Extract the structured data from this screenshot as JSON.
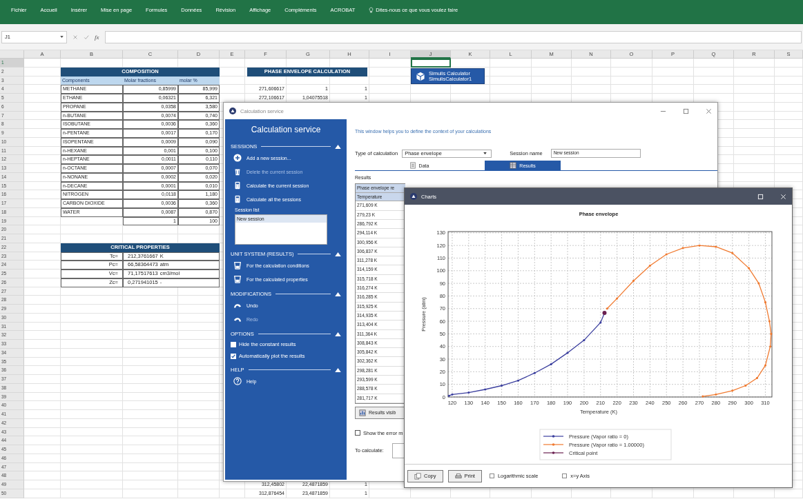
{
  "ribbon": {
    "tabs": [
      {
        "label": "Fichier",
        "selected": false
      },
      {
        "label": "Accueil",
        "selected": false
      },
      {
        "label": "Insérer",
        "selected": false
      },
      {
        "label": "Mise en page",
        "selected": false
      },
      {
        "label": "Formules",
        "selected": false
      },
      {
        "label": "Données",
        "selected": false
      },
      {
        "label": "Révision",
        "selected": false
      },
      {
        "label": "Affichage",
        "selected": false
      },
      {
        "label": "Compléments",
        "selected": false
      },
      {
        "label": "ACROBAT",
        "selected": false
      }
    ],
    "search_hint": "Dites-nous ce que vous voulez faire"
  },
  "formula_bar": {
    "name_box": "J1",
    "function_label": "fx"
  },
  "sheet": {
    "columns": [
      {
        "label": "A",
        "selected": false
      },
      {
        "label": "B",
        "selected": false
      },
      {
        "label": "C",
        "selected": false
      },
      {
        "label": "D",
        "selected": false
      },
      {
        "label": "E",
        "selected": false
      },
      {
        "label": "F",
        "selected": false
      },
      {
        "label": "G",
        "selected": false
      },
      {
        "label": "H",
        "selected": false
      },
      {
        "label": "I",
        "selected": false
      },
      {
        "label": "J",
        "selected": true
      },
      {
        "label": "K",
        "selected": false
      },
      {
        "label": "L",
        "selected": false
      },
      {
        "label": "M",
        "selected": false
      },
      {
        "label": "N",
        "selected": false
      },
      {
        "label": "O",
        "selected": false
      },
      {
        "label": "P",
        "selected": false
      },
      {
        "label": "Q",
        "selected": false
      },
      {
        "label": "R",
        "selected": false
      },
      {
        "label": "S",
        "selected": false
      }
    ],
    "rows": [
      {
        "label": "1",
        "selected": true
      },
      {
        "label": "2",
        "selected": false
      },
      {
        "label": "3",
        "selected": false
      },
      {
        "label": "4",
        "selected": false
      },
      {
        "label": "5",
        "selected": false
      },
      {
        "label": "6",
        "selected": false
      },
      {
        "label": "7",
        "selected": false
      },
      {
        "label": "8",
        "selected": false
      },
      {
        "label": "9",
        "selected": false
      },
      {
        "label": "10",
        "selected": false
      },
      {
        "label": "11",
        "selected": false
      },
      {
        "label": "12",
        "selected": false
      },
      {
        "label": "13",
        "selected": false
      },
      {
        "label": "14",
        "selected": false
      },
      {
        "label": "15",
        "selected": false
      },
      {
        "label": "16",
        "selected": false
      },
      {
        "label": "17",
        "selected": false
      },
      {
        "label": "18",
        "selected": false
      },
      {
        "label": "19",
        "selected": false
      },
      {
        "label": "20",
        "selected": false
      },
      {
        "label": "21",
        "selected": false
      },
      {
        "label": "22",
        "selected": false
      },
      {
        "label": "23",
        "selected": false
      },
      {
        "label": "24",
        "selected": false
      },
      {
        "label": "25",
        "selected": false
      },
      {
        "label": "26",
        "selected": false
      },
      {
        "label": "27",
        "selected": false
      },
      {
        "label": "28",
        "selected": false
      },
      {
        "label": "29",
        "selected": false
      },
      {
        "label": "30",
        "selected": false
      },
      {
        "label": "31",
        "selected": false
      },
      {
        "label": "32",
        "selected": false
      },
      {
        "label": "33",
        "selected": false
      },
      {
        "label": "34",
        "selected": false
      },
      {
        "label": "35",
        "selected": false
      },
      {
        "label": "36",
        "selected": false
      },
      {
        "label": "37",
        "selected": false
      },
      {
        "label": "38",
        "selected": false
      },
      {
        "label": "39",
        "selected": false
      },
      {
        "label": "40",
        "selected": false
      },
      {
        "label": "41",
        "selected": false
      },
      {
        "label": "42",
        "selected": false
      },
      {
        "label": "43",
        "selected": false
      },
      {
        "label": "44",
        "selected": false
      },
      {
        "label": "45",
        "selected": false
      },
      {
        "label": "46",
        "selected": false
      },
      {
        "label": "47",
        "selected": false
      },
      {
        "label": "48",
        "selected": false
      },
      {
        "label": "49",
        "selected": false
      },
      {
        "label": "50",
        "selected": false
      }
    ]
  },
  "composition": {
    "title": "COMPOSITION",
    "headers": [
      "Components",
      "Molar fractions",
      "molar %"
    ],
    "rows": [
      {
        "component": "METHANE",
        "fraction": "0,85999",
        "percent": "85,999"
      },
      {
        "component": "ETHANE",
        "fraction": "0,06321",
        "percent": "6,321"
      },
      {
        "component": "PROPANE",
        "fraction": "0,0358",
        "percent": "3,580"
      },
      {
        "component": "n-BUTANE",
        "fraction": "0,0074",
        "percent": "0,740"
      },
      {
        "component": "ISOBUTANE",
        "fraction": "0,0036",
        "percent": "0,360"
      },
      {
        "component": "n-PENTANE",
        "fraction": "0,0017",
        "percent": "0,170"
      },
      {
        "component": "ISOPENTANE",
        "fraction": "0,0009",
        "percent": "0,090"
      },
      {
        "component": "n-HEXANE",
        "fraction": "0,001",
        "percent": "0,100"
      },
      {
        "component": "n-HEPTANE",
        "fraction": "0,0011",
        "percent": "0,110"
      },
      {
        "component": "n-OCTANE",
        "fraction": "0,0007",
        "percent": "0,070"
      },
      {
        "component": "n-NONANE",
        "fraction": "0,0002",
        "percent": "0,020"
      },
      {
        "component": "n-DECANE",
        "fraction": "0,0001",
        "percent": "0,010"
      },
      {
        "component": "NITROGEN",
        "fraction": "0,0118",
        "percent": "1,180"
      },
      {
        "component": "CARBON DIOXIDE",
        "fraction": "0,0036",
        "percent": "0,360"
      },
      {
        "component": "WATER",
        "fraction": "0,0087",
        "percent": "0,870"
      }
    ],
    "total": {
      "fraction": "1",
      "percent": "100"
    }
  },
  "critical_properties": {
    "title": "CRITICAL PROPERTIES",
    "rows": [
      {
        "label": "Tc=",
        "value": "212,3761667",
        "unit": "K"
      },
      {
        "label": "Pc=",
        "value": "66,58364473",
        "unit": "atm"
      },
      {
        "label": "Vc=",
        "value": "71,17517613",
        "unit": "cm3/mol"
      },
      {
        "label": "Zc=",
        "value": "0,271941015",
        "unit": "-"
      }
    ]
  },
  "phase_envelope": {
    "title": "PHASE ENVELOPE CALCULATION",
    "rows_above_window": [
      [
        "271,606617",
        "1",
        "1"
      ],
      [
        "272,106617",
        "1,04075518",
        "1"
      ]
    ],
    "rows_below_window": [
      [
        "312,45802",
        "22,4871859",
        "1"
      ],
      [
        "312,876454",
        "23,4871859",
        "1"
      ]
    ]
  },
  "simulis_button": {
    "line_1": "Simulis Calculator",
    "line_2": "SimulisCalculator1"
  },
  "calc_window": {
    "title": "Calculation service",
    "panel": {
      "title": "Calculation service",
      "sections": [
        {
          "heading": "SESSIONS",
          "expanded": true,
          "items": [
            {
              "kind": "add",
              "label": "Add a new session...",
              "disabled": false
            },
            {
              "kind": "delete",
              "label": "Delete the current session",
              "disabled": true
            },
            {
              "kind": "calculate",
              "label": "Calculate the current session",
              "disabled": false
            },
            {
              "kind": "calculate",
              "label": "Calculate all the sessions",
              "disabled": false
            },
            {
              "kind": "list",
              "label": "Session list",
              "entries": [
                {
                  "label": "New session",
                  "selected": true
                }
              ]
            }
          ]
        },
        {
          "heading": "UNIT SYSTEM (RESULTS)",
          "expanded": true,
          "items": [
            {
              "kind": "unit",
              "label": "For the calculation conditions",
              "disabled": false
            },
            {
              "kind": "unit",
              "label": "For the calculated properties",
              "disabled": false
            }
          ]
        },
        {
          "heading": "MODIFICATIONS",
          "expanded": true,
          "items": [
            {
              "kind": "undo",
              "label": "Undo",
              "disabled": false
            },
            {
              "kind": "redo",
              "label": "Redo",
              "disabled": true
            }
          ]
        },
        {
          "heading": "OPTIONS",
          "expanded": true,
          "items": [
            {
              "kind": "checkbox",
              "label": "Hide the constant results",
              "checked": false
            },
            {
              "kind": "checkbox",
              "label": "Automatically plot the results",
              "checked": true
            }
          ]
        },
        {
          "heading": "HELP",
          "expanded": true,
          "items": [
            {
              "kind": "help",
              "label": "Help",
              "disabled": false
            }
          ]
        }
      ]
    },
    "main": {
      "intro": "This window helps you to define the context of your calculations",
      "type_label": "Type of calculation",
      "type_value": "Phase envelope",
      "session_label": "Session name",
      "session_value": "New session",
      "tabs": [
        {
          "label": "Data",
          "selected": false
        },
        {
          "label": "Results",
          "selected": true
        }
      ],
      "results_label": "Results",
      "table_title": "Phase envelope re",
      "column_header": "Temperature",
      "temperatures": [
        "271,609 K",
        "279,23 K",
        "286,792 K",
        "294,114 K",
        "300,956 K",
        "306,837 K",
        "311,278 K",
        "314,159 K",
        "315,718 K",
        "316,274 K",
        "316,285 K",
        "315,925 K",
        "314,935 K",
        "313,404 K",
        "311,364 K",
        "308,843 K",
        "305,842 K",
        "302,362 K",
        "298,281 K",
        "293,599 K",
        "288,578 K",
        "281,717 K"
      ],
      "results_button": "Results visib",
      "error_option": {
        "label": "Show the error m",
        "checked": false
      },
      "calculate_label": "To calculate:"
    }
  },
  "charts_window": {
    "title": "Charts",
    "chart_data": {
      "type": "line",
      "grid": true,
      "legend": true,
      "title": "Phase envelope",
      "xlabel": "Temperature (K)",
      "ylabel": "Pressure (atm)",
      "xlim": [
        117.5,
        314
      ],
      "ylim": [
        0,
        131
      ],
      "xticks": [
        120,
        130,
        140,
        150,
        160,
        170,
        180,
        190,
        200,
        210,
        220,
        230,
        240,
        250,
        260,
        270,
        280,
        290,
        300,
        310
      ],
      "yticks": [
        0,
        10,
        20,
        30,
        40,
        50,
        60,
        70,
        80,
        90,
        100,
        110,
        120,
        130
      ],
      "series": [
        {
          "name": "Pressure (Vapor ratio = 0)",
          "color": "#3b3f9e",
          "marker": true,
          "x": [
            118,
            120,
            130,
            140,
            150,
            160,
            170,
            180,
            190,
            200,
            210,
            212.4
          ],
          "values": [
            1,
            2,
            3.5,
            6,
            9,
            13,
            19,
            26,
            35,
            45,
            59,
            66.5
          ]
        },
        {
          "name": "Pressure (Vapor ratio = 1.00000)",
          "color": "#f07a30",
          "marker": true,
          "x": [
            214,
            220,
            230,
            240,
            250,
            260,
            270,
            280,
            290,
            300,
            306,
            310,
            312.5,
            313.5,
            313,
            310,
            305,
            298,
            290,
            280,
            272
          ],
          "values": [
            70,
            78,
            92,
            104,
            113,
            118,
            120,
            119,
            114,
            102,
            90,
            75,
            60,
            50,
            40,
            25,
            15,
            9,
            5,
            2,
            0.5
          ]
        },
        {
          "name": "Critical point",
          "color": "#6a2050",
          "marker": true,
          "x": [
            212.4
          ],
          "values": [
            66.6
          ]
        }
      ]
    },
    "buttons": [
      "Copy",
      "Print"
    ],
    "options": [
      {
        "label": "Logarithmic scale",
        "checked": false
      },
      {
        "label": "x=y Axis",
        "checked": false
      }
    ]
  }
}
